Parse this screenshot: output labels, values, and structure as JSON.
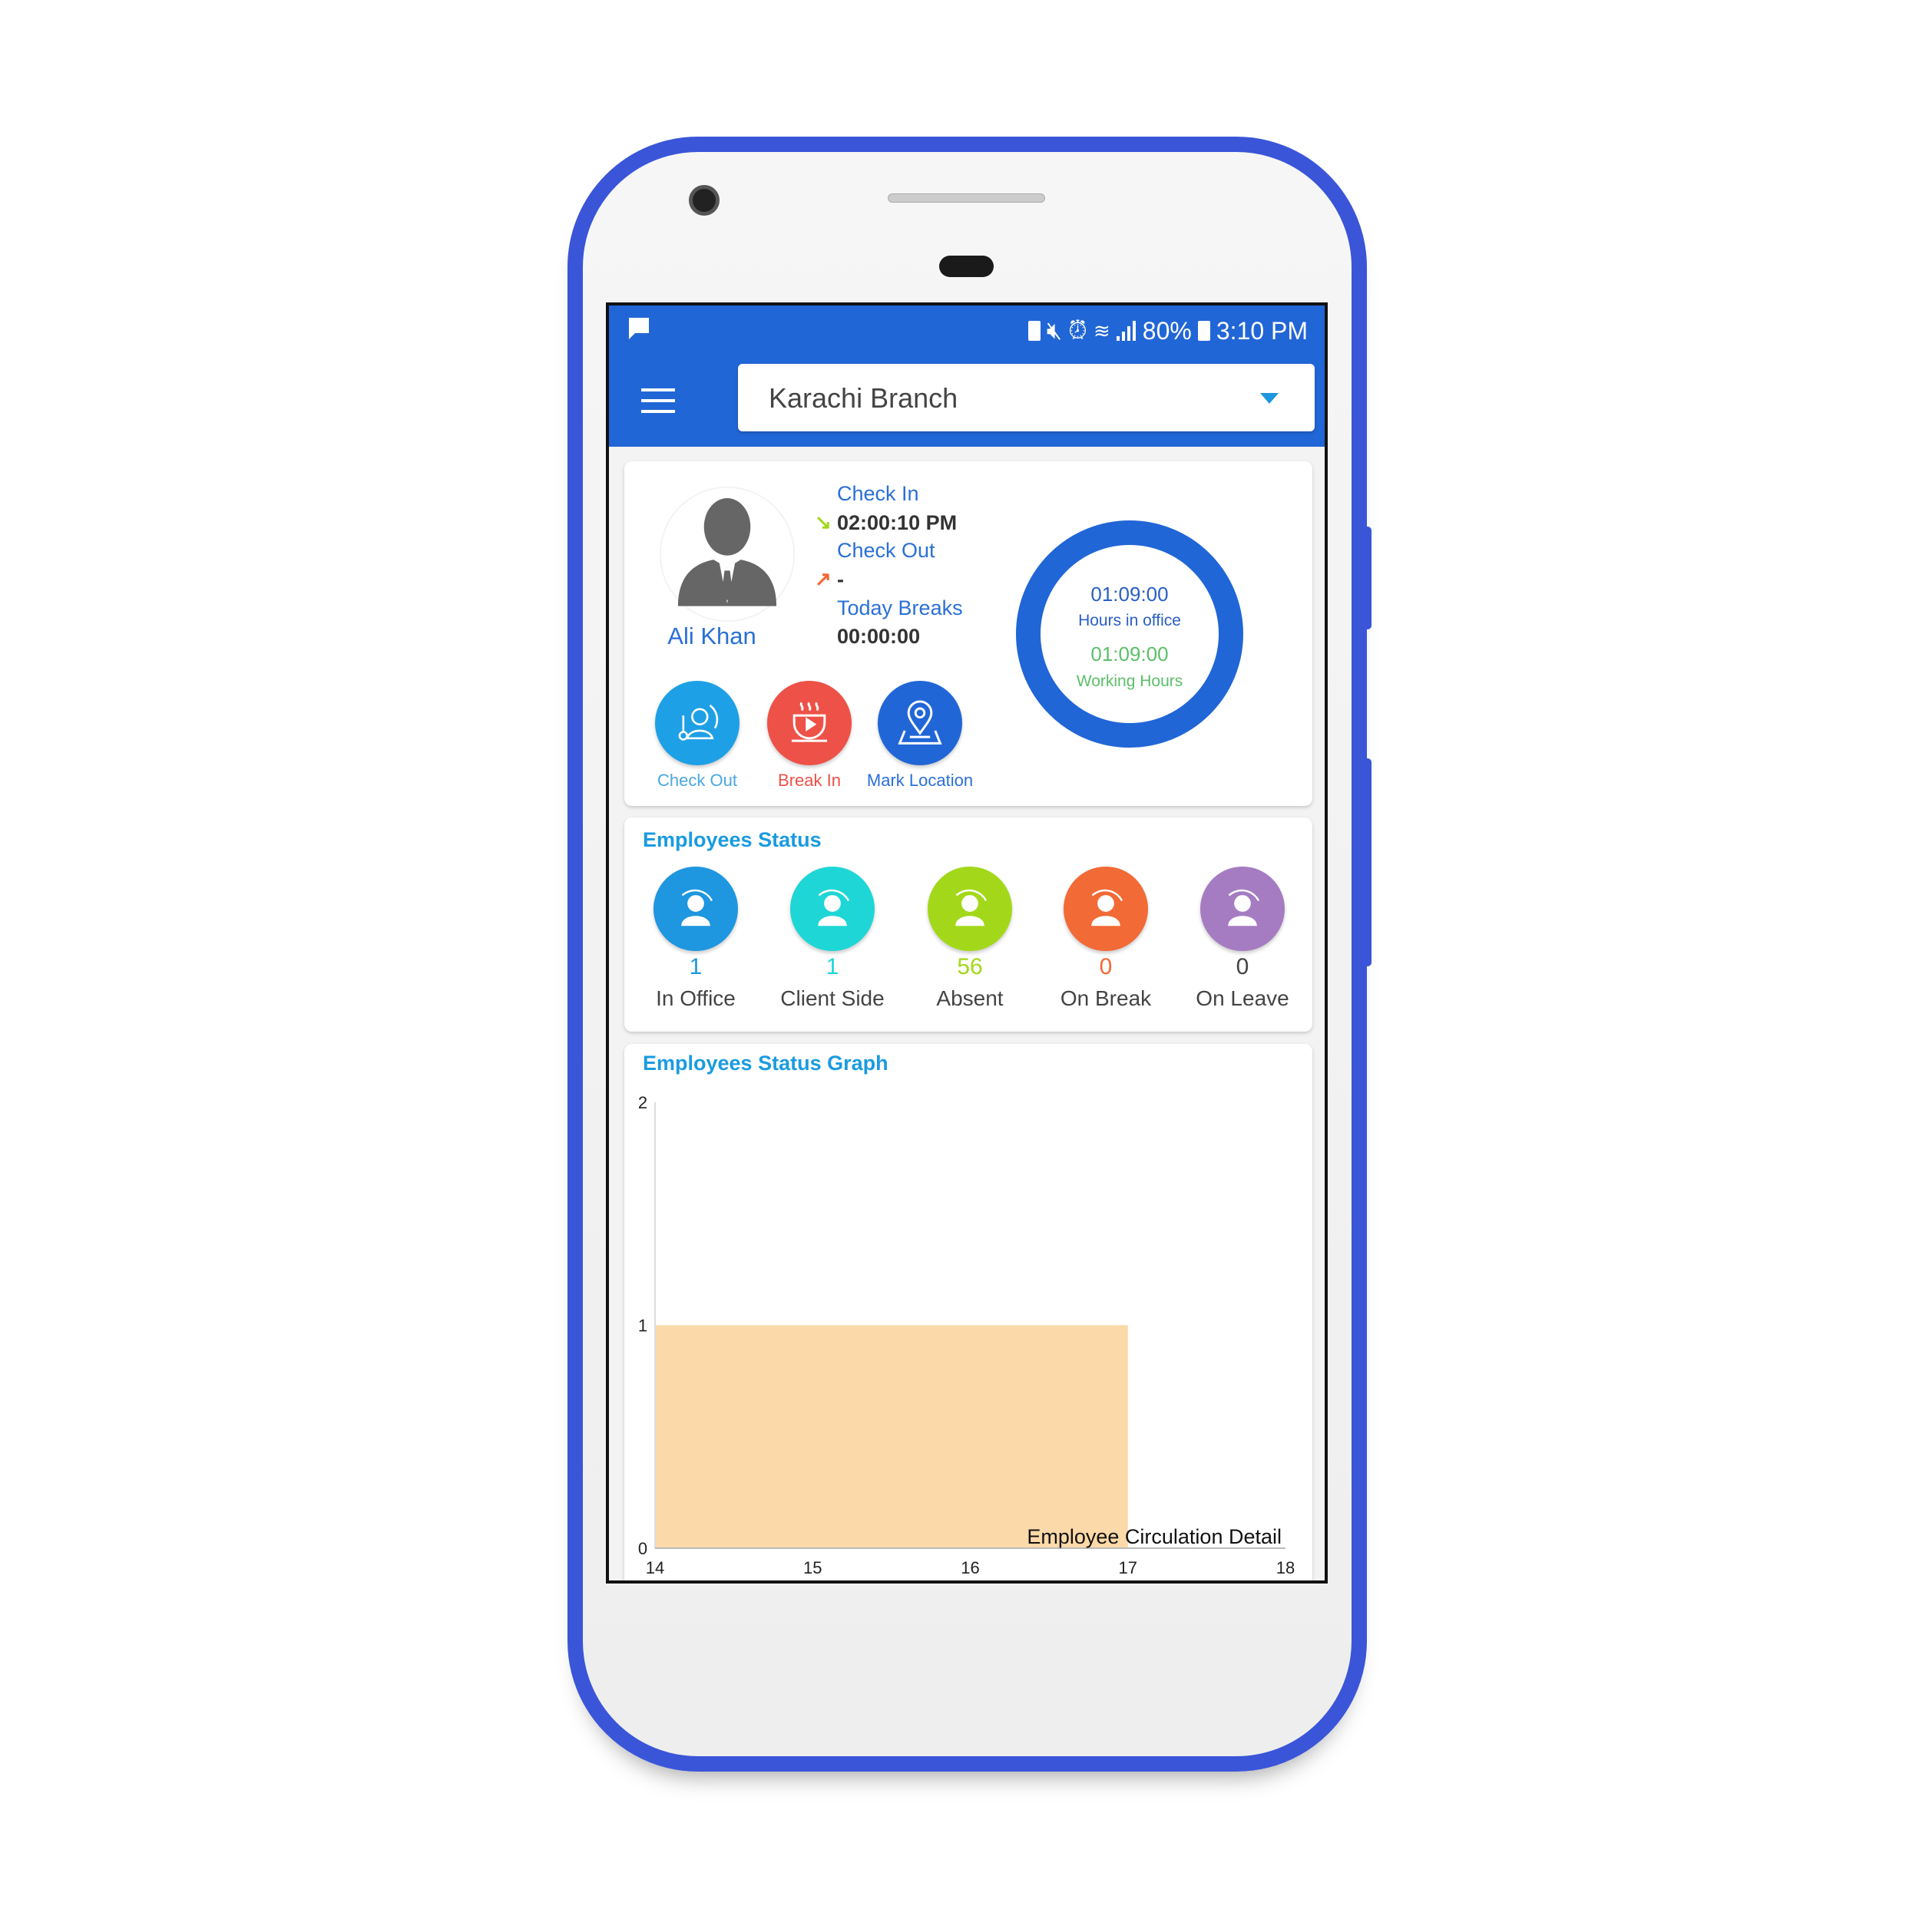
{
  "status_bar": {
    "notification_icon": "chat-bubble-icon",
    "battery": "80%",
    "time": "3:10 PM",
    "icons": [
      "sim-icon",
      "mute-icon",
      "alarm-icon",
      "wifi-icon",
      "signal-icon",
      "battery-charging-icon"
    ]
  },
  "app_bar": {
    "menu_icon": "hamburger-icon",
    "branch_select": {
      "value": "Karachi Branch"
    }
  },
  "profile": {
    "name": "Ali Khan",
    "check_in_label": "Check In",
    "check_in_time": "02:00:10 PM",
    "check_out_label": "Check Out",
    "check_out_time": "-",
    "breaks_label": "Today Breaks",
    "breaks_time": "00:00:00",
    "hours_in_office": "01:09:00",
    "hours_in_office_label": "Hours in office",
    "working_hours": "01:09:00",
    "working_hours_label": "Working Hours",
    "actions": [
      {
        "label": "Check Out",
        "color": "#1ea0e6"
      },
      {
        "label": "Break In",
        "color": "#ee5147"
      },
      {
        "label": "Mark Location",
        "color": "#2166d6"
      }
    ]
  },
  "employees_status": {
    "title": "Employees Status",
    "items": [
      {
        "label": "In Office",
        "count": "1",
        "color": "#1e96e0"
      },
      {
        "label": "Client Side",
        "count": "1",
        "color": "#1fd6d6"
      },
      {
        "label": "Absent",
        "count": "56",
        "color": "#a3d81a"
      },
      {
        "label": "On Break",
        "count": "0",
        "color": "#f26a35"
      },
      {
        "label": "On Leave",
        "count": "0",
        "color": "#a57cc1"
      }
    ]
  },
  "graph": {
    "title": "Employees Status Graph"
  },
  "chart_data": {
    "type": "area",
    "title": "",
    "xlabel": "",
    "ylabel": "",
    "xlim": [
      14,
      18
    ],
    "ylim": [
      0,
      2
    ],
    "x_ticks": [
      "14",
      "15",
      "16",
      "17",
      "18"
    ],
    "y_ticks": [
      "0",
      "1",
      "2"
    ],
    "series": [
      {
        "name": "Employee Circulation Detail",
        "color": "#fcd9a8",
        "bars": [
          {
            "from": 14,
            "to": 17,
            "value": 1
          }
        ]
      }
    ],
    "legend": "bottom-right",
    "grid": false
  }
}
